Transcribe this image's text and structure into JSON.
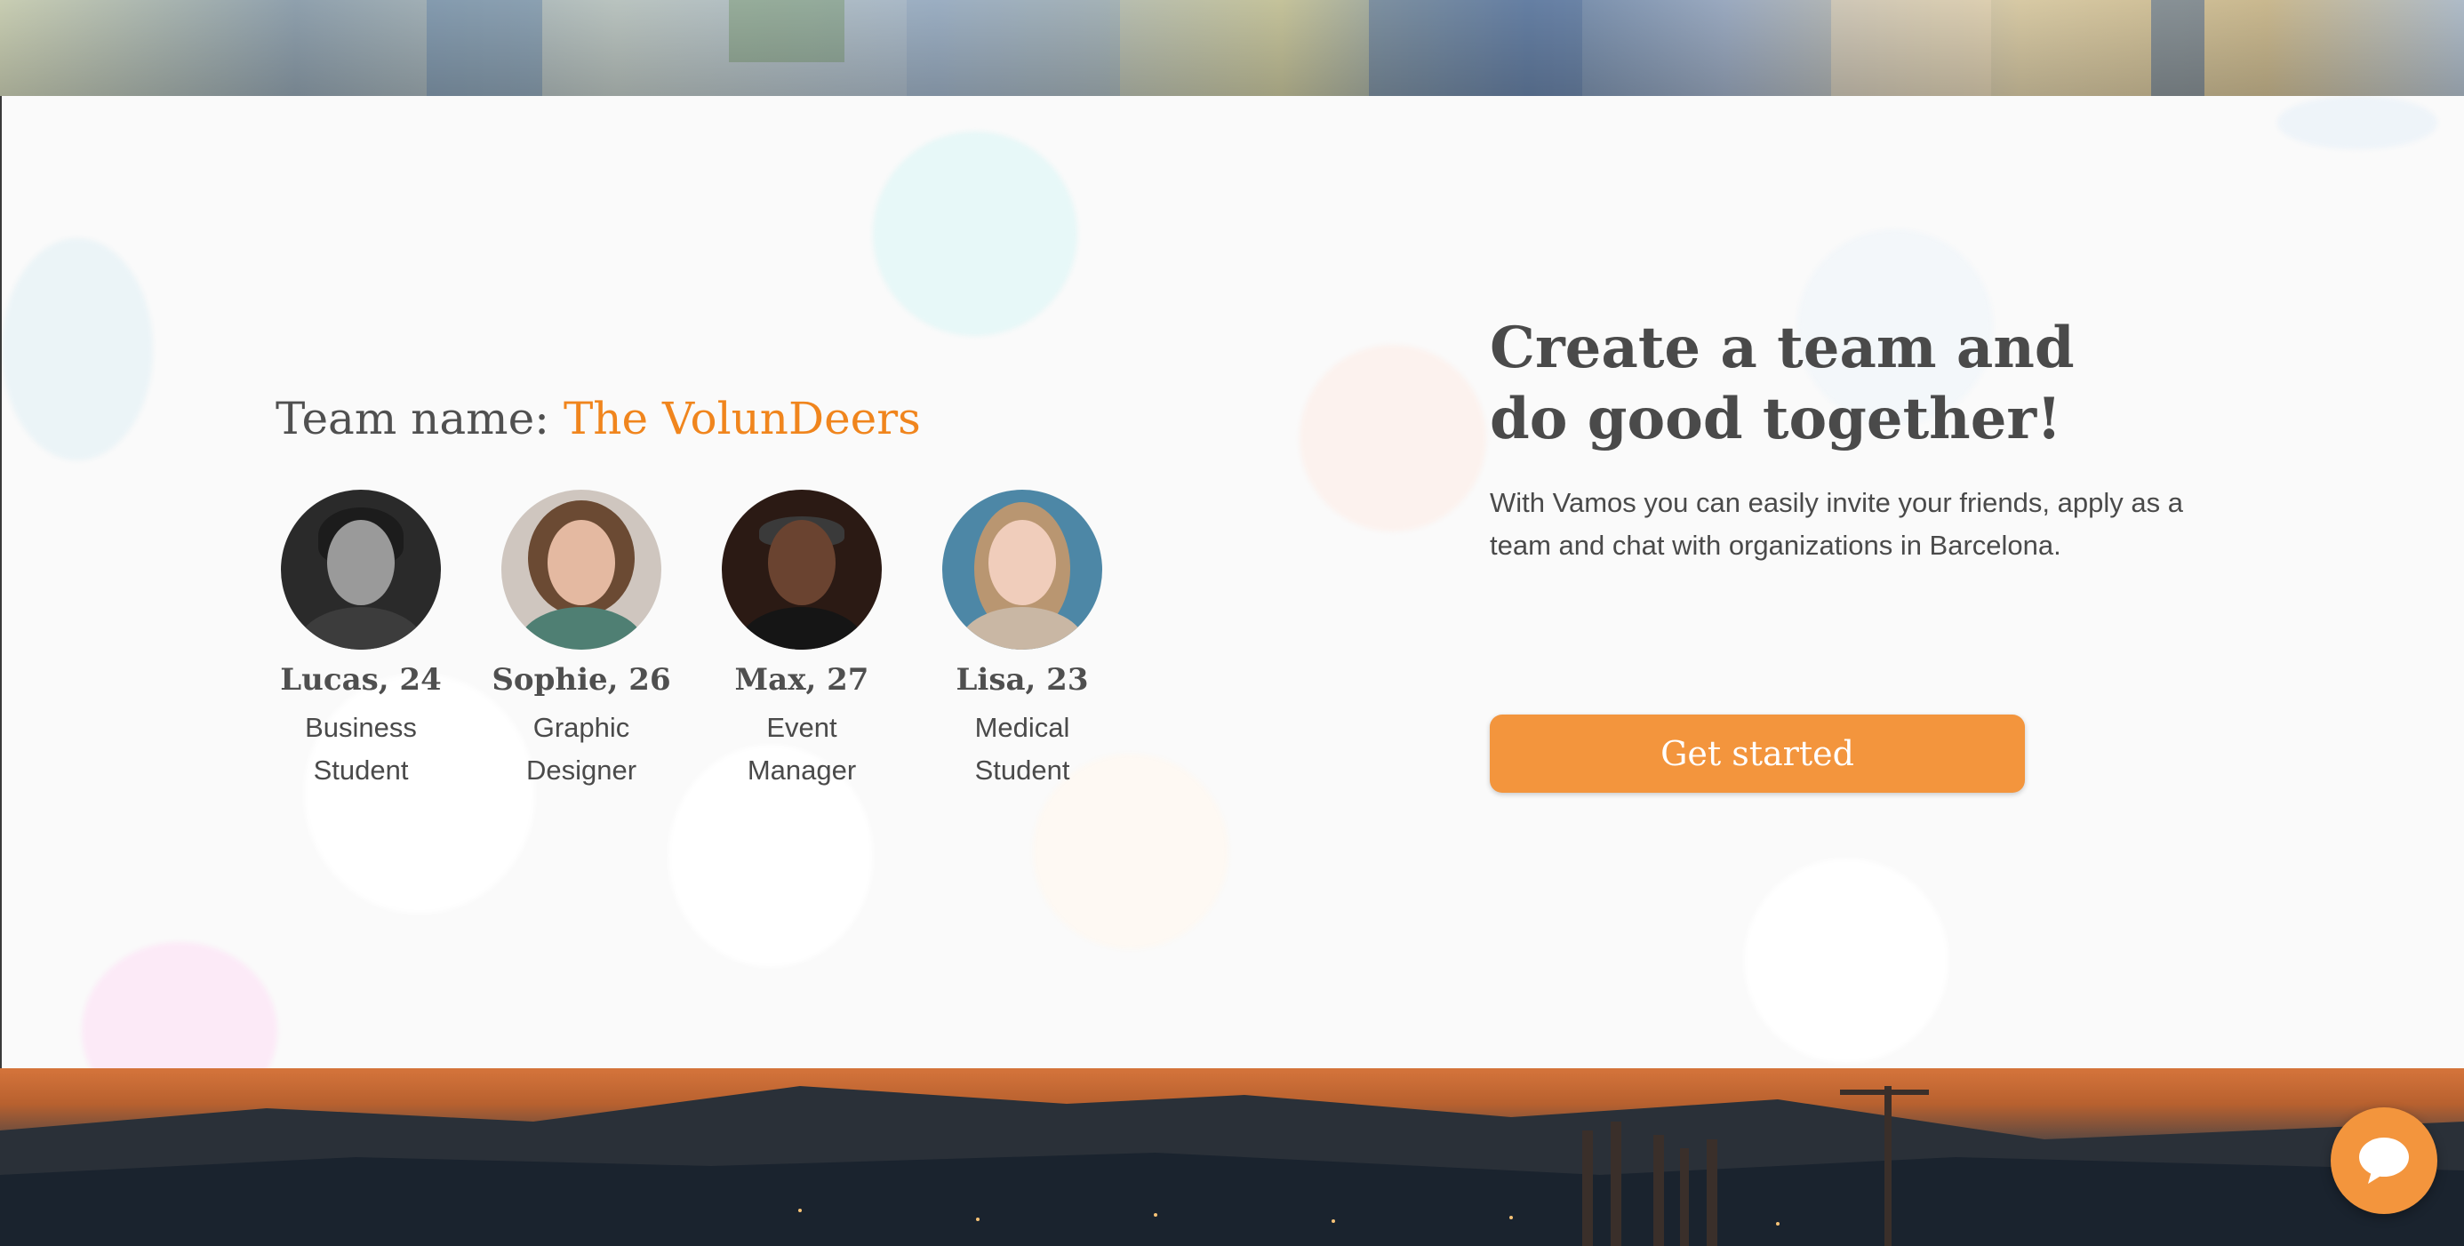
{
  "team": {
    "label": "Team name: ",
    "name": "The VolunDeers",
    "members": [
      {
        "name": "Lucas, 24",
        "role": "Business\nStudent"
      },
      {
        "name": "Sophie, 26",
        "role": "Graphic\nDesigner"
      },
      {
        "name": "Max, 27",
        "role": "Event\nManager"
      },
      {
        "name": "Lisa, 23",
        "role": "Medical\nStudent"
      }
    ]
  },
  "promo": {
    "headline": "Create a team and\ndo good together!",
    "description": "With Vamos you can easily invite your friends, apply as a\nteam and chat with organizations in Barcelona.",
    "cta_label": "Get started"
  },
  "colors": {
    "accent": "#f0851d",
    "button": "#f3953d",
    "text": "#4a4a4a"
  },
  "icons": {
    "chat": "chat-bubble-icon"
  }
}
